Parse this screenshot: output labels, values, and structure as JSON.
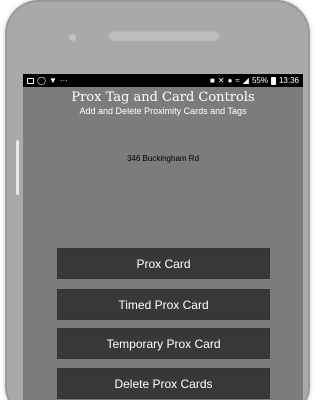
{
  "statusbar": {
    "left_icons": [
      "image-icon",
      "whatsapp-icon",
      "shield-icon",
      "more-icon"
    ],
    "more": "···",
    "battery_percent": "55%",
    "time": "13:36"
  },
  "header": {
    "title": "Prox Tag and Card Controls",
    "subtitle": "Add and Delete Proximity Cards and Tags"
  },
  "main": {
    "address": "346 Buckingham Rd",
    "buttons": [
      {
        "label": "Prox Card"
      },
      {
        "label": "Timed Prox Card"
      },
      {
        "label": "Temporary Prox Card"
      },
      {
        "label": "Delete Prox Cards"
      }
    ]
  },
  "colors": {
    "screen_bg": "#7c7c7c",
    "button_bg": "#383838",
    "statusbar_bg": "#000000",
    "phone_body": "#a9a9a9"
  }
}
